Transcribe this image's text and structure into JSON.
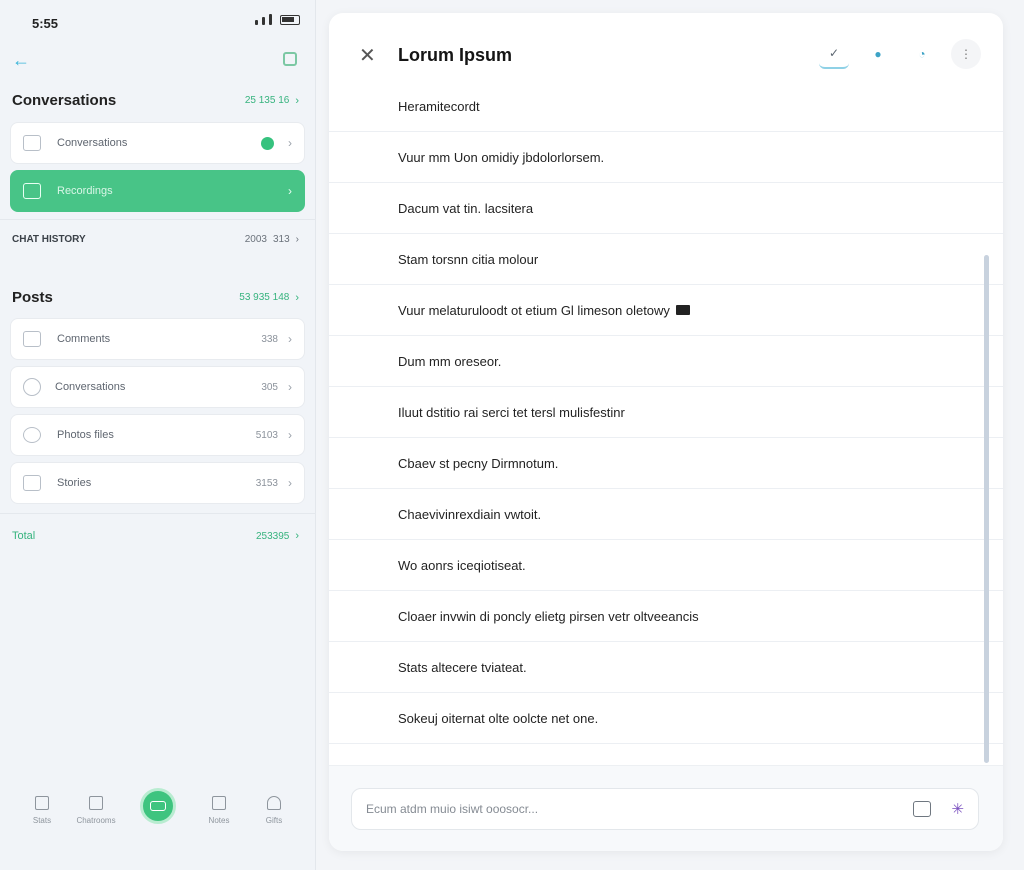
{
  "status": {
    "time": "5:55"
  },
  "left": {
    "section1": {
      "title": "Conversations",
      "meta": "25 135 16",
      "chev": "›"
    },
    "cards1": [
      {
        "label": "Conversations",
        "chev": "›"
      },
      {
        "label": "Recordings",
        "chev": "›"
      }
    ],
    "info_row": {
      "label": "CHAT HISTORY",
      "meta1": "2003",
      "meta2": "313",
      "chev": "›"
    },
    "section2": {
      "title": "Posts",
      "meta": "53 935 148",
      "chev": "›"
    },
    "cards2": [
      {
        "label": "Comments",
        "value": "338",
        "chev": "›"
      },
      {
        "label": "Conversations",
        "value": "305",
        "chev": "›"
      },
      {
        "label": "Photos files",
        "value": "5103",
        "chev": "›"
      },
      {
        "label": "Stories",
        "value": "3153",
        "chev": "›"
      }
    ],
    "total_row": {
      "label": "Total",
      "meta": "253395",
      "chev": "›"
    },
    "nav": [
      {
        "label": "Stats"
      },
      {
        "label": "Chatrooms"
      },
      {
        "label": "Notes"
      },
      {
        "label": "Gifts"
      }
    ]
  },
  "right": {
    "title": "Lorum Ipsum",
    "messages": [
      "Heramitecordt",
      "Vuur mm Uon omidiy jbdolorlorsem.",
      "Dacum vat tin. lacsitera",
      "Stam torsnn citia molour",
      "Vuur melaturuloodt ot etium Gl limeson oletowy",
      "Dum mm oreseor.",
      "Iluut dstitio rai serci tet tersl mulisfestinr",
      "Cbaev st pecny Dirmnotum.",
      "Chaevivinrexdiain vwtoit.",
      "Wo aonrs iceqiotiseat.",
      "Cloaer invwin di poncly elietg pirsen vetr oltveeancis",
      "Stats altecere tviateat.",
      "Sokeuj oiternat olte oolcte net one."
    ],
    "composer": {
      "placeholder": "Ecum atdm muio isiwt ooosocr..."
    }
  }
}
